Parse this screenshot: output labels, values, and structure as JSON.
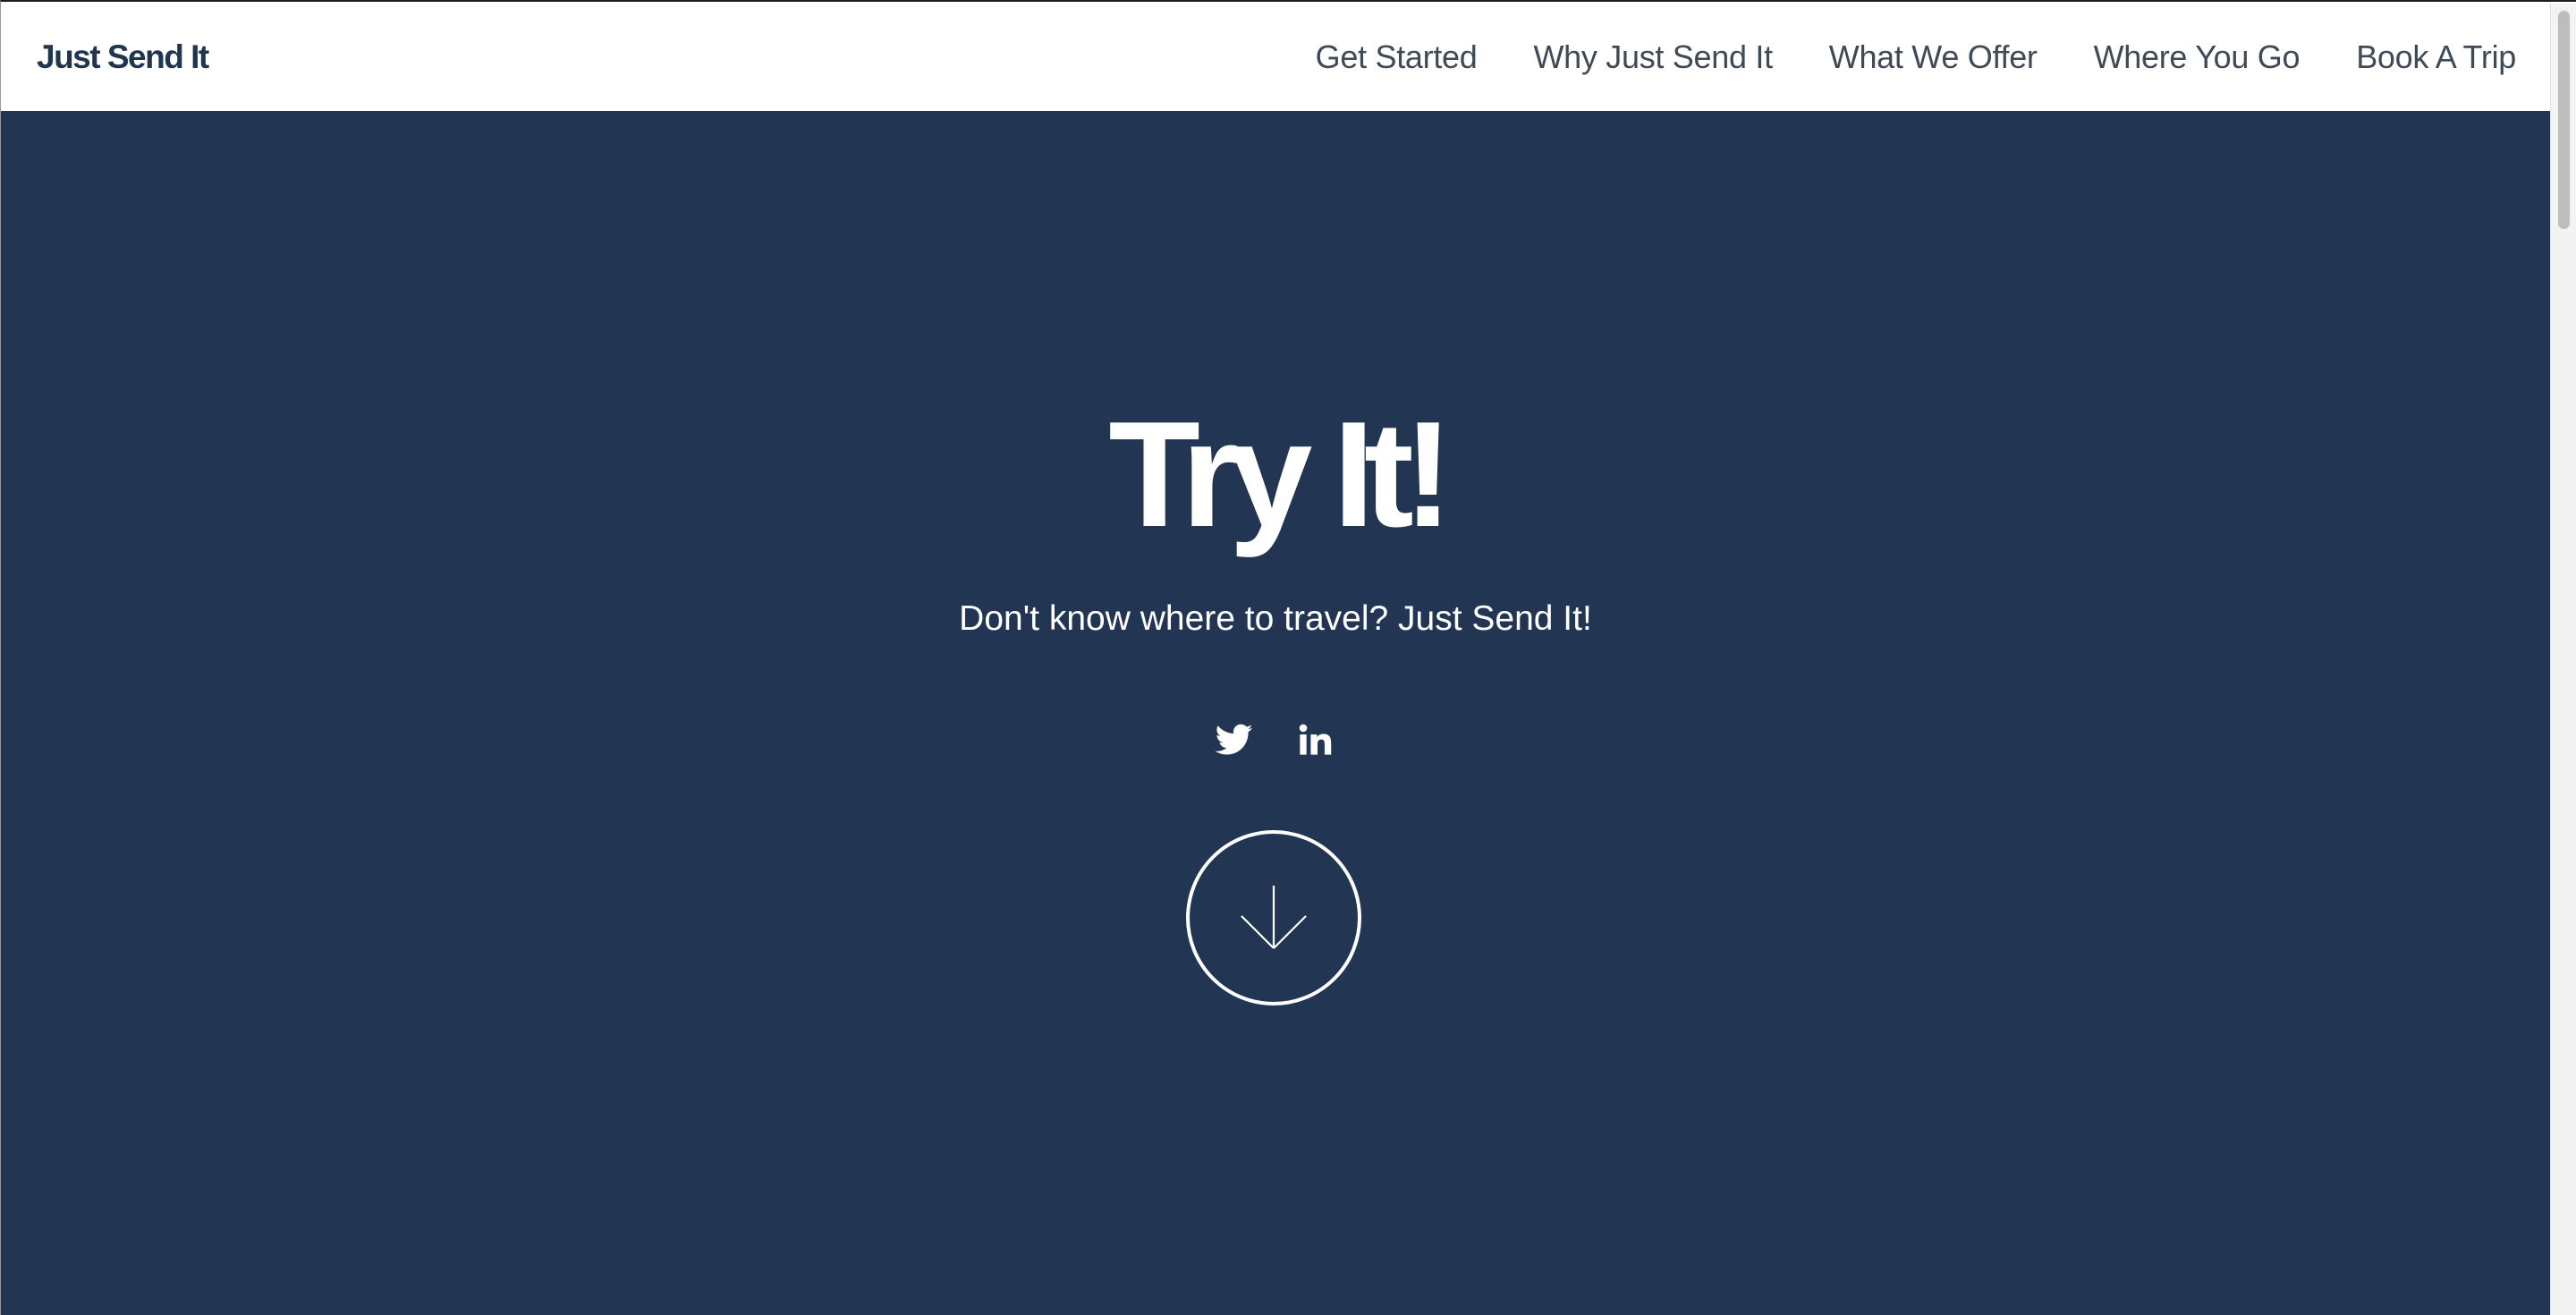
{
  "header": {
    "brand": "Just Send It",
    "nav": [
      {
        "label": "Get Started"
      },
      {
        "label": "Why Just Send It"
      },
      {
        "label": "What We Offer"
      },
      {
        "label": "Where You Go"
      },
      {
        "label": "Book A Trip"
      }
    ]
  },
  "hero": {
    "title": "Try It!",
    "subtitle": "Don't know where to travel? Just Send It!",
    "socials": [
      {
        "icon": "twitter-icon"
      },
      {
        "icon": "linkedin-icon"
      }
    ],
    "scroll_icon": "arrow-down-icon"
  },
  "colors": {
    "hero_background": "#223653",
    "brand": "#22354f",
    "nav_text": "#3f4a56",
    "hero_text": "#ffffff"
  }
}
